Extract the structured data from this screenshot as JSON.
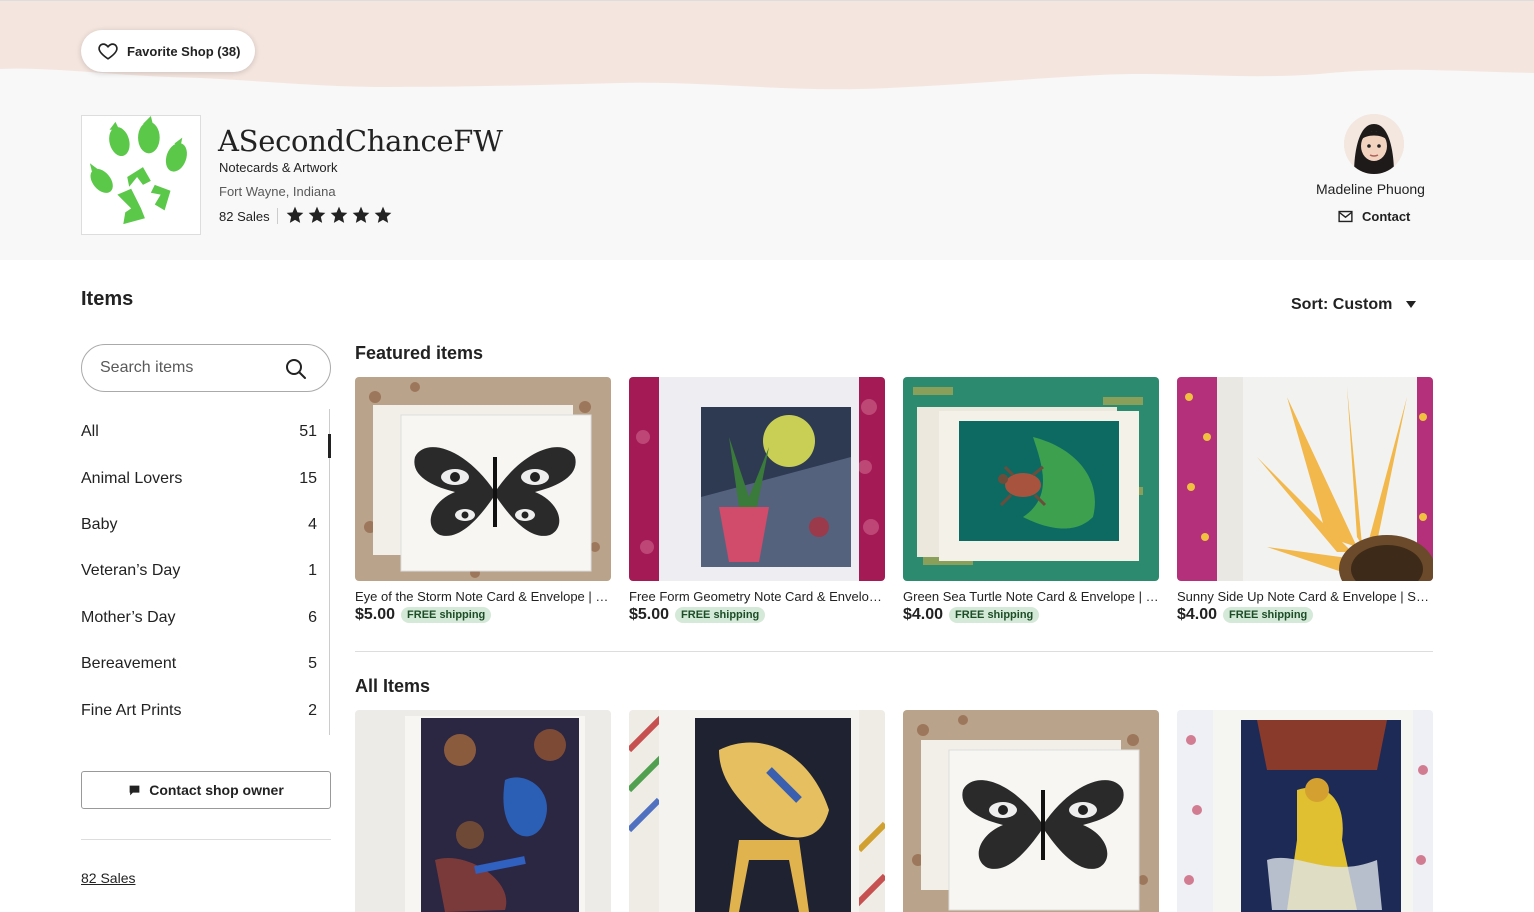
{
  "header": {
    "favorite_label": "Favorite Shop (38)",
    "shop_name": "ASecondChanceFW",
    "tagline": "Notecards & Artwork",
    "location": "Fort Wayne, Indiana",
    "sales": "82 Sales",
    "rating_stars": 5,
    "owner_name": "Madeline Phuong",
    "contact_label": "Contact"
  },
  "sidebar": {
    "heading": "Items",
    "search_placeholder": "Search items",
    "categories": [
      {
        "label": "All",
        "count": "51"
      },
      {
        "label": "Animal Lovers",
        "count": "15"
      },
      {
        "label": "Baby",
        "count": "4"
      },
      {
        "label": "Veteran’s Day",
        "count": "1"
      },
      {
        "label": "Mother’s Day",
        "count": "6"
      },
      {
        "label": "Bereavement",
        "count": "5"
      },
      {
        "label": "Fine Art Prints",
        "count": "2"
      }
    ],
    "contact_owner_label": "Contact shop owner",
    "sales_link": "82 Sales"
  },
  "sort": {
    "label": "Sort: Custom"
  },
  "featured": {
    "title": "Featured items",
    "items": [
      {
        "title": "Eye of the Storm Note Card & Envelope | Butterfly Art Card",
        "price": "$5.00",
        "badge": "FREE shipping"
      },
      {
        "title": "Free Form Geometry Note Card & Envelope | Abstract Art",
        "price": "$5.00",
        "badge": "FREE shipping"
      },
      {
        "title": "Green Sea Turtle Note Card & Envelope | Ocean Art Card",
        "price": "$4.00",
        "badge": "FREE shipping"
      },
      {
        "title": "Sunny Side Up Note Card & Envelope | Sunflower Art",
        "price": "$4.00",
        "badge": "FREE shipping"
      }
    ]
  },
  "all_items": {
    "title": "All Items"
  },
  "colors": {
    "banner_wave": "#f5e5df",
    "free_shipping_bg": "#d4e9d7",
    "logo_green": "#5cc84a"
  }
}
